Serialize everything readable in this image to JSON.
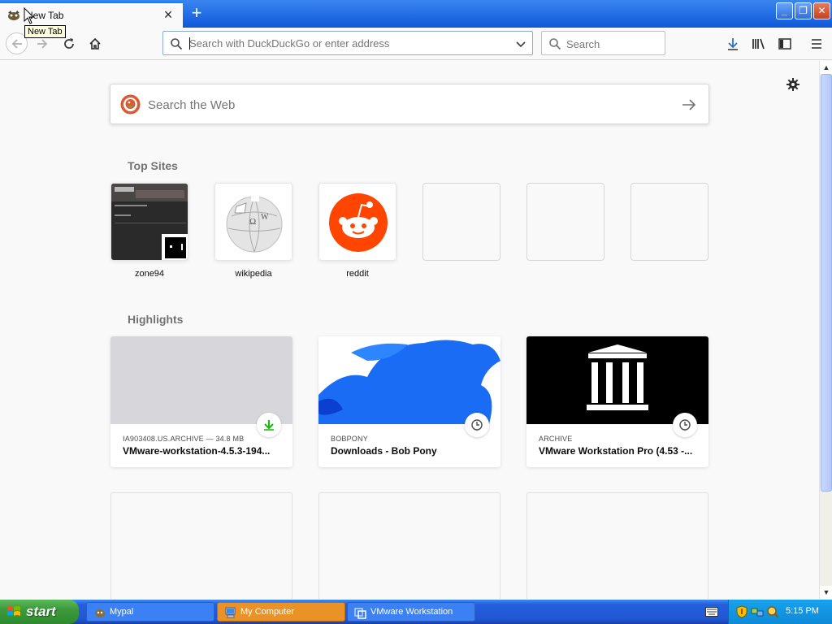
{
  "browser": {
    "tab_title": "New Tab",
    "tooltip": "New Tab",
    "new_tab_symbol": "+",
    "close_symbol": "×",
    "window_buttons": {
      "minimize": "_",
      "maximize": "❐",
      "close": "✕"
    },
    "urlbar_placeholder": "Search with DuckDuckGo or enter address",
    "searchbar_placeholder": "Search"
  },
  "newtab": {
    "websearch_placeholder": "Search the Web",
    "top_sites_title": "Top Sites",
    "top_sites": [
      {
        "label": "zone94"
      },
      {
        "label": "wikipedia"
      },
      {
        "label": "reddit"
      },
      {
        "label": ""
      },
      {
        "label": ""
      },
      {
        "label": ""
      }
    ],
    "highlights_title": "Highlights",
    "highlights": [
      {
        "context": "IA903408.US.ARCHIVE — 34.8 MB",
        "title": "VMware-workstation-4.5.3-194...",
        "badge": "download-icon"
      },
      {
        "context": "BOBPONY",
        "title": "Downloads - Bob Pony",
        "badge": "clock-icon"
      },
      {
        "context": "ARCHIVE",
        "title": "VMware Workstation Pro (4.53 -...",
        "badge": "clock-icon"
      }
    ]
  },
  "taskbar": {
    "start_label": "start",
    "tasks": [
      {
        "label": "Mypal"
      },
      {
        "label": "My Computer"
      },
      {
        "label": "VMware Workstation"
      }
    ],
    "clock": "5:15 PM"
  },
  "colors": {
    "accent": "#0a84ff",
    "reddit": "#ff4500",
    "download_green": "#12bc00",
    "taskbar_blue": "#245edb",
    "start_green": "#3c9a3c"
  }
}
